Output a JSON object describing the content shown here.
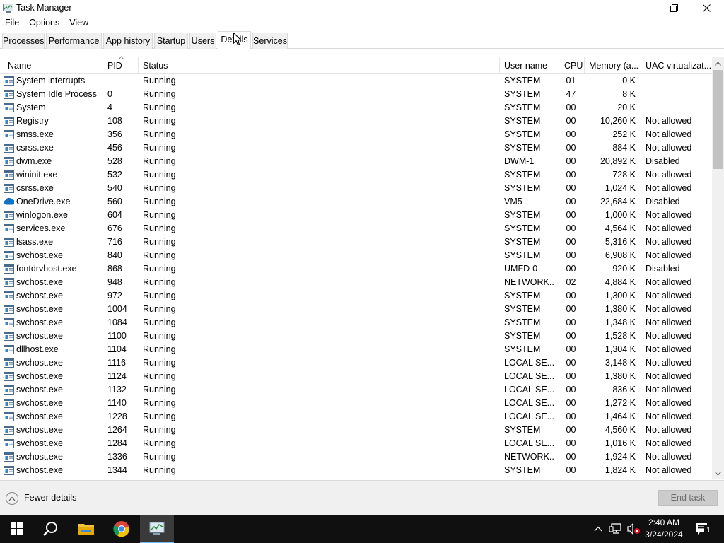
{
  "window": {
    "title": "Task Manager"
  },
  "menu": [
    "File",
    "Options",
    "View"
  ],
  "tabs": [
    "Processes",
    "Performance",
    "App history",
    "Startup",
    "Users",
    "Details",
    "Services"
  ],
  "active_tab": "Details",
  "columns": [
    "Name",
    "PID",
    "Status",
    "User name",
    "CPU",
    "Memory (a...",
    "UAC virtualizat..."
  ],
  "rows": [
    {
      "name": "System interrupts",
      "pid": "-",
      "status": "Running",
      "user": "SYSTEM",
      "cpu": "01",
      "mem": "0 K",
      "uac": "",
      "icon": "process-icon"
    },
    {
      "name": "System Idle Process",
      "pid": "0",
      "status": "Running",
      "user": "SYSTEM",
      "cpu": "47",
      "mem": "8 K",
      "uac": "",
      "icon": "process-icon"
    },
    {
      "name": "System",
      "pid": "4",
      "status": "Running",
      "user": "SYSTEM",
      "cpu": "00",
      "mem": "20 K",
      "uac": "",
      "icon": "process-icon"
    },
    {
      "name": "Registry",
      "pid": "108",
      "status": "Running",
      "user": "SYSTEM",
      "cpu": "00",
      "mem": "10,260 K",
      "uac": "Not allowed",
      "icon": "process-icon"
    },
    {
      "name": "smss.exe",
      "pid": "356",
      "status": "Running",
      "user": "SYSTEM",
      "cpu": "00",
      "mem": "252 K",
      "uac": "Not allowed",
      "icon": "process-icon"
    },
    {
      "name": "csrss.exe",
      "pid": "456",
      "status": "Running",
      "user": "SYSTEM",
      "cpu": "00",
      "mem": "884 K",
      "uac": "Not allowed",
      "icon": "process-icon"
    },
    {
      "name": "dwm.exe",
      "pid": "528",
      "status": "Running",
      "user": "DWM-1",
      "cpu": "00",
      "mem": "20,892 K",
      "uac": "Disabled",
      "icon": "process-icon"
    },
    {
      "name": "wininit.exe",
      "pid": "532",
      "status": "Running",
      "user": "SYSTEM",
      "cpu": "00",
      "mem": "728 K",
      "uac": "Not allowed",
      "icon": "process-icon"
    },
    {
      "name": "csrss.exe",
      "pid": "540",
      "status": "Running",
      "user": "SYSTEM",
      "cpu": "00",
      "mem": "1,024 K",
      "uac": "Not allowed",
      "icon": "process-icon"
    },
    {
      "name": "OneDrive.exe",
      "pid": "560",
      "status": "Running",
      "user": "VM5",
      "cpu": "00",
      "mem": "22,684 K",
      "uac": "Disabled",
      "icon": "onedrive-icon"
    },
    {
      "name": "winlogon.exe",
      "pid": "604",
      "status": "Running",
      "user": "SYSTEM",
      "cpu": "00",
      "mem": "1,000 K",
      "uac": "Not allowed",
      "icon": "process-icon"
    },
    {
      "name": "services.exe",
      "pid": "676",
      "status": "Running",
      "user": "SYSTEM",
      "cpu": "00",
      "mem": "4,564 K",
      "uac": "Not allowed",
      "icon": "process-icon"
    },
    {
      "name": "lsass.exe",
      "pid": "716",
      "status": "Running",
      "user": "SYSTEM",
      "cpu": "00",
      "mem": "5,316 K",
      "uac": "Not allowed",
      "icon": "process-icon"
    },
    {
      "name": "svchost.exe",
      "pid": "840",
      "status": "Running",
      "user": "SYSTEM",
      "cpu": "00",
      "mem": "6,908 K",
      "uac": "Not allowed",
      "icon": "process-icon"
    },
    {
      "name": "fontdrvhost.exe",
      "pid": "868",
      "status": "Running",
      "user": "UMFD-0",
      "cpu": "00",
      "mem": "920 K",
      "uac": "Disabled",
      "icon": "process-icon"
    },
    {
      "name": "svchost.exe",
      "pid": "948",
      "status": "Running",
      "user": "NETWORK...",
      "cpu": "02",
      "mem": "4,884 K",
      "uac": "Not allowed",
      "icon": "process-icon"
    },
    {
      "name": "svchost.exe",
      "pid": "972",
      "status": "Running",
      "user": "SYSTEM",
      "cpu": "00",
      "mem": "1,300 K",
      "uac": "Not allowed",
      "icon": "process-icon"
    },
    {
      "name": "svchost.exe",
      "pid": "1004",
      "status": "Running",
      "user": "SYSTEM",
      "cpu": "00",
      "mem": "1,380 K",
      "uac": "Not allowed",
      "icon": "process-icon"
    },
    {
      "name": "svchost.exe",
      "pid": "1084",
      "status": "Running",
      "user": "SYSTEM",
      "cpu": "00",
      "mem": "1,348 K",
      "uac": "Not allowed",
      "icon": "process-icon"
    },
    {
      "name": "svchost.exe",
      "pid": "1100",
      "status": "Running",
      "user": "SYSTEM",
      "cpu": "00",
      "mem": "1,528 K",
      "uac": "Not allowed",
      "icon": "process-icon"
    },
    {
      "name": "dllhost.exe",
      "pid": "1104",
      "status": "Running",
      "user": "SYSTEM",
      "cpu": "00",
      "mem": "1,304 K",
      "uac": "Not allowed",
      "icon": "process-icon"
    },
    {
      "name": "svchost.exe",
      "pid": "1116",
      "status": "Running",
      "user": "LOCAL SE...",
      "cpu": "00",
      "mem": "3,148 K",
      "uac": "Not allowed",
      "icon": "process-icon"
    },
    {
      "name": "svchost.exe",
      "pid": "1124",
      "status": "Running",
      "user": "LOCAL SE...",
      "cpu": "00",
      "mem": "1,380 K",
      "uac": "Not allowed",
      "icon": "process-icon"
    },
    {
      "name": "svchost.exe",
      "pid": "1132",
      "status": "Running",
      "user": "LOCAL SE...",
      "cpu": "00",
      "mem": "836 K",
      "uac": "Not allowed",
      "icon": "process-icon"
    },
    {
      "name": "svchost.exe",
      "pid": "1140",
      "status": "Running",
      "user": "LOCAL SE...",
      "cpu": "00",
      "mem": "1,272 K",
      "uac": "Not allowed",
      "icon": "process-icon"
    },
    {
      "name": "svchost.exe",
      "pid": "1228",
      "status": "Running",
      "user": "LOCAL SE...",
      "cpu": "00",
      "mem": "1,464 K",
      "uac": "Not allowed",
      "icon": "process-icon"
    },
    {
      "name": "svchost.exe",
      "pid": "1264",
      "status": "Running",
      "user": "SYSTEM",
      "cpu": "00",
      "mem": "4,560 K",
      "uac": "Not allowed",
      "icon": "process-icon"
    },
    {
      "name": "svchost.exe",
      "pid": "1284",
      "status": "Running",
      "user": "LOCAL SE...",
      "cpu": "00",
      "mem": "1,016 K",
      "uac": "Not allowed",
      "icon": "process-icon"
    },
    {
      "name": "svchost.exe",
      "pid": "1336",
      "status": "Running",
      "user": "NETWORK...",
      "cpu": "00",
      "mem": "1,924 K",
      "uac": "Not allowed",
      "icon": "process-icon"
    },
    {
      "name": "svchost.exe",
      "pid": "1344",
      "status": "Running",
      "user": "SYSTEM",
      "cpu": "00",
      "mem": "1,824 K",
      "uac": "Not allowed",
      "icon": "process-icon"
    }
  ],
  "footer": {
    "fewer_details": "Fewer details",
    "end_task": "End task"
  },
  "taskbar": {
    "clock_time": "2:40 AM",
    "clock_date": "3/24/2024",
    "notification_count": "1",
    "pinned": [
      "windows-start-icon",
      "search-icon",
      "file-explorer-icon",
      "chrome-icon",
      "task-manager-icon"
    ]
  },
  "colors": {
    "taskbar_bg": "#101010",
    "accent": "#76b9ed",
    "tab_bg": "#f0f0f0"
  }
}
